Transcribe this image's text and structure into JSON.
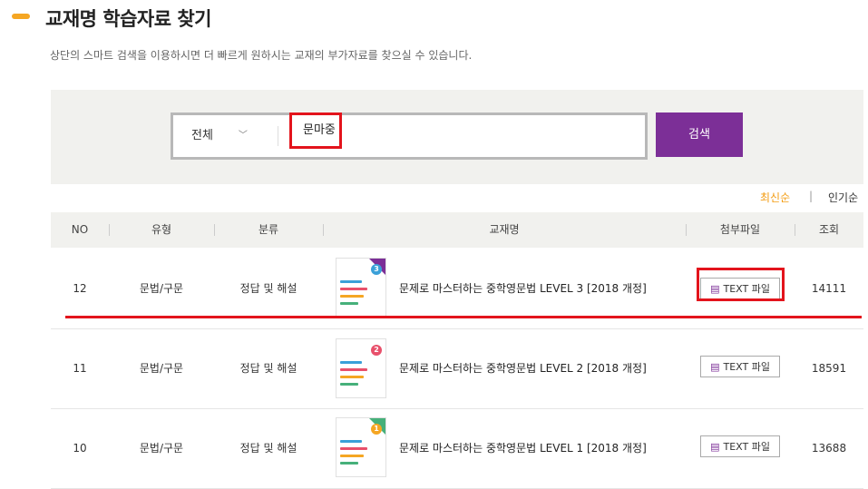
{
  "page": {
    "title": "교재명 학습자료 찾기",
    "description": "상단의 스마트 검색을 이용하시면 더 빠르게 원하시는 교재의 부가자료를 찾으실 수 있습니다."
  },
  "search": {
    "scope": "전체",
    "query": "문마중",
    "button_label": "검색"
  },
  "sort": {
    "newest": "최신순",
    "separator": "|",
    "popular": "인기순"
  },
  "table": {
    "columns": [
      "NO",
      "유형",
      "분류",
      "교재명",
      "첨부파일",
      "조회"
    ],
    "rows": [
      {
        "no": "12",
        "type": "문법/구문",
        "category": "정답 및 해설",
        "title": "문제로 마스터하는 중학영문법 LEVEL 3 [2018 개정]",
        "file": "TEXT 파일",
        "views": "14111",
        "badge": "3"
      },
      {
        "no": "11",
        "type": "문법/구문",
        "category": "정답 및 해설",
        "title": "문제로 마스터하는 중학영문법 LEVEL 2 [2018 개정]",
        "file": "TEXT 파일",
        "views": "18591",
        "badge": "2"
      },
      {
        "no": "10",
        "type": "문법/구문",
        "category": "정답 및 해설",
        "title": "문제로 마스터하는 중학영문법 LEVEL 1 [2018 개정]",
        "file": "TEXT 파일",
        "views": "13688",
        "badge": "1"
      }
    ]
  },
  "colors": {
    "accent": "#f5a623",
    "search_button": "#7c2f97",
    "highlight": "#e3141c",
    "badge_colors": [
      "#3aa0d8",
      "#e8506b",
      "#f5a623"
    ]
  }
}
